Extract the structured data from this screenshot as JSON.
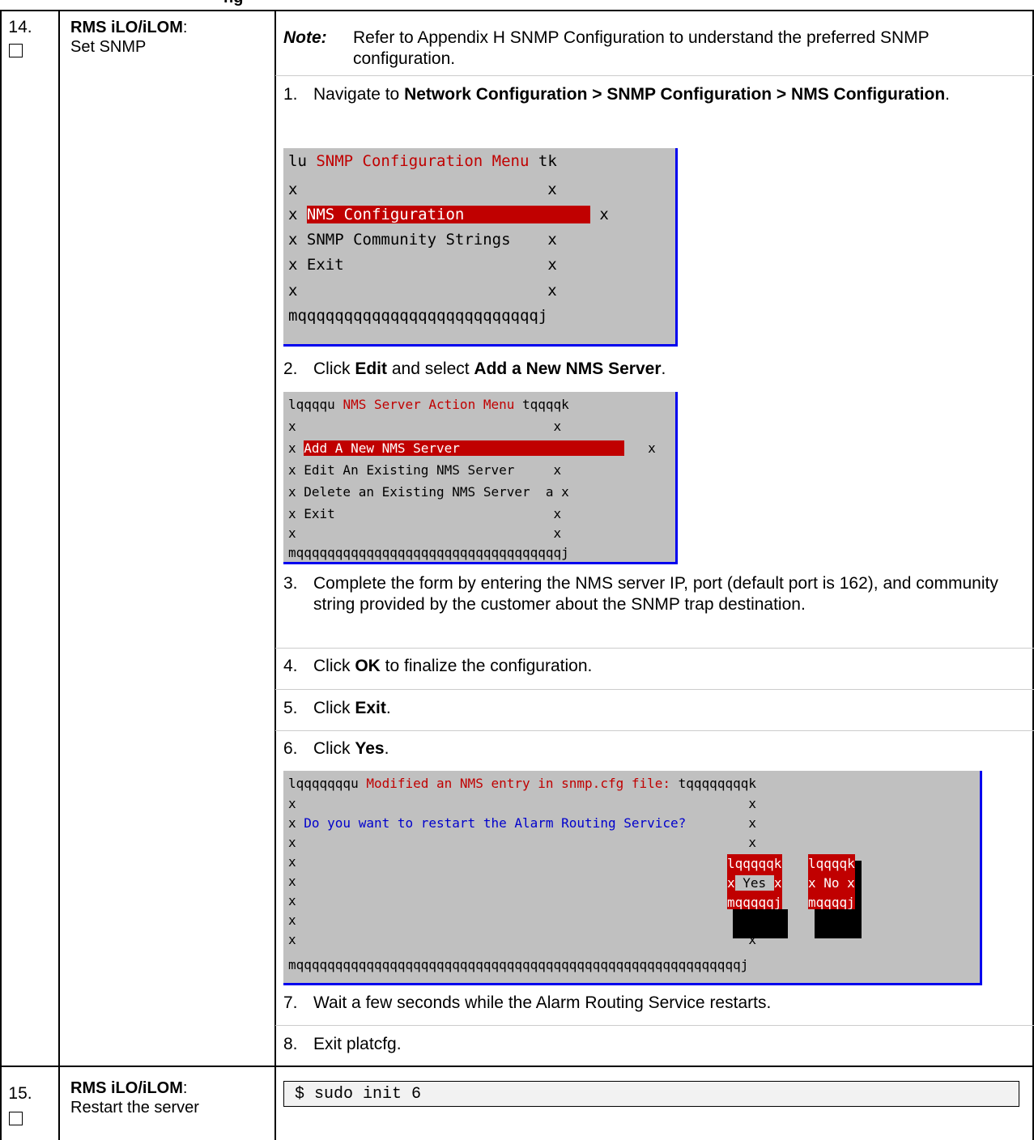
{
  "header_fragment": "ng",
  "steps": [
    {
      "number": "14.",
      "title_bold": "RMS iLO/iLOM",
      "title_colon": ":",
      "title_rest": "Set SNMP",
      "note_label": "Note:",
      "note_text": "Refer to Appendix H SNMP Configuration to understand the preferred SNMP configuration.",
      "items": [
        {
          "n": "1.",
          "pre": "Navigate to ",
          "bold": "Network Configuration > SNMP Configuration > NMS Configuration",
          "post": "."
        },
        {
          "n": "2.",
          "pre": "Click ",
          "bold": "Edit",
          "mid": " and select ",
          "bold2": "Add a New NMS Server",
          "post": "."
        },
        {
          "n": "3.",
          "text": "Complete the form by entering the NMS server IP, port (default port is 162), and community string provided by the customer about the SNMP trap destination."
        },
        {
          "n": "4.",
          "pre": "Click ",
          "bold": "OK",
          "post": " to finalize the configuration."
        },
        {
          "n": "5.",
          "pre": "Click ",
          "bold": "Exit",
          "post": "."
        },
        {
          "n": "6.",
          "pre": "Click ",
          "bold": "Yes",
          "post": "."
        },
        {
          "n": "7.",
          "text": "Wait a few seconds while the Alarm Routing Service restarts."
        },
        {
          "n": "8.",
          "text": "Exit platcfg."
        }
      ],
      "term1": {
        "title_left": "lu ",
        "title": "SNMP Configuration Menu",
        "title_right": " tk",
        "options": [
          "NMS Configuration",
          "SNMP Community Strings",
          "Exit"
        ],
        "bottom": "mqqqqqqqqqqqqqqqqqqqqqqqqqqj"
      },
      "term2": {
        "title_left": "lqqqqu ",
        "title": "NMS Server Action Menu",
        "title_right": " tqqqqk",
        "options": [
          "Add A New NMS Server",
          "Edit An Existing NMS Server",
          "Delete an Existing NMS Server  a",
          "Exit"
        ],
        "bottom": "mqqqqqqqqqqqqqqqqqqqqqqqqqqqqqqqqqqj"
      },
      "term3": {
        "title_left": "lqqqqqqqu ",
        "title": "Modified an NMS entry in snmp.cfg file:",
        "title_right": " tqqqqqqqqk",
        "question": "Do you want to restart the Alarm Routing Service?",
        "yes_top": "lqqqqqk",
        "yes_label": " Yes ",
        "yes_bottom": "mqqqqqj",
        "no_top": "lqqqqk",
        "no_label": " No ",
        "no_bottom": "mqqqqj",
        "bottom": "mqqqqqqqqqqqqqqqqqqqqqqqqqqqqqqqqqqqqqqqqqqqqqqqqqqqqqqqqqj"
      }
    },
    {
      "number": "15.",
      "title_bold": "RMS iLO/iLOM",
      "title_colon": ":",
      "title_rest": "Restart the server",
      "command": "$ sudo init 6"
    }
  ]
}
